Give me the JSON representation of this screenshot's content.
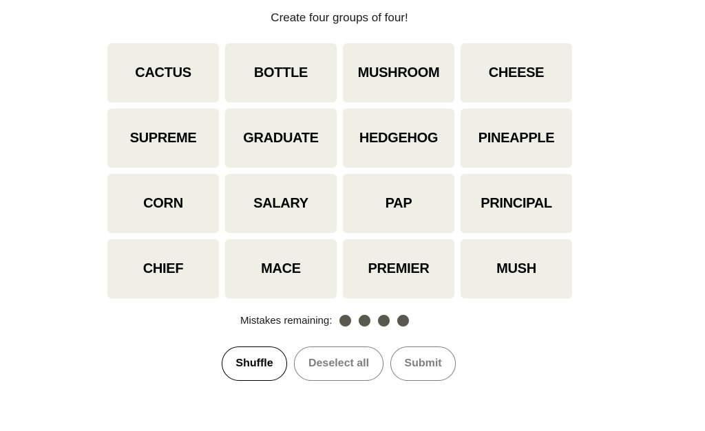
{
  "header": {
    "subtitle": "Create four groups of four!"
  },
  "grid": {
    "tiles": [
      "CACTUS",
      "BOTTLE",
      "MUSHROOM",
      "CHEESE",
      "SUPREME",
      "GRADUATE",
      "HEDGEHOG",
      "PINEAPPLE",
      "CORN",
      "SALARY",
      "PAP",
      "PRINCIPAL",
      "CHIEF",
      "MACE",
      "PREMIER",
      "MUSH"
    ]
  },
  "mistakes": {
    "label": "Mistakes remaining:",
    "remaining": 4,
    "dot_color": "#5a594e"
  },
  "buttons": {
    "shuffle": "Shuffle",
    "deselect": "Deselect all",
    "submit": "Submit"
  },
  "colors": {
    "tile_bg": "#efefe6"
  }
}
